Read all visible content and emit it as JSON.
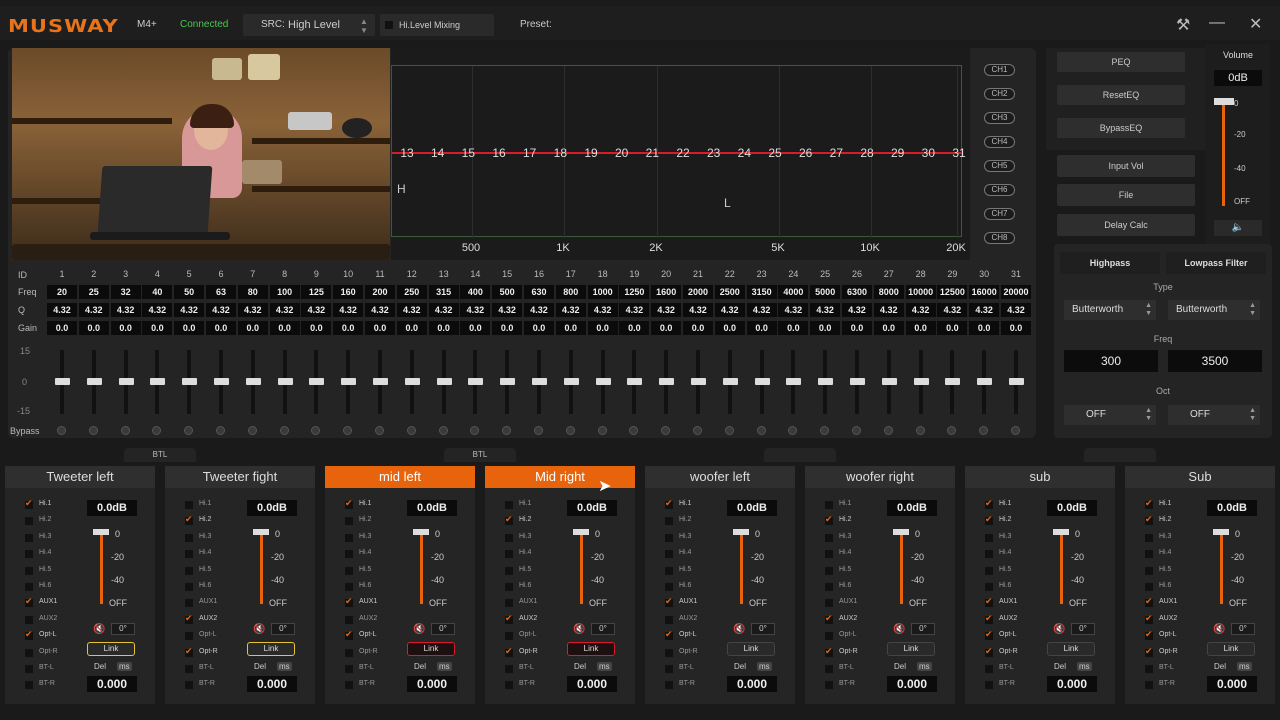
{
  "app": {
    "brand": "MUSWAY",
    "model": "M4+",
    "status": "Connected",
    "src_label": "SRC:",
    "src_value": "High Level",
    "mixing_label": "Hi.Level Mixing",
    "preset_label": "Preset:"
  },
  "colors": {
    "accent": "#e8640c",
    "status": "#4ac94a",
    "eq_curve": "#d81c2c",
    "selected_link": "#e8c33a",
    "active_link": "#d81c2c"
  },
  "eq": {
    "band_numbers": [
      "13",
      "14",
      "15",
      "16",
      "17",
      "18",
      "19",
      "20",
      "21",
      "22",
      "23",
      "24",
      "25",
      "26",
      "27",
      "28",
      "29",
      "30",
      "31"
    ],
    "freq_axis": [
      "500",
      "1K",
      "2K",
      "5K",
      "10K",
      "20K"
    ],
    "h_label": "H",
    "l_label": "L",
    "channels": [
      "CH1",
      "CH2",
      "CH3",
      "CH4",
      "CH5",
      "CH6",
      "CH7",
      "CH8"
    ]
  },
  "table": {
    "row_labels": {
      "id": "ID",
      "freq": "Freq",
      "q": "Q",
      "gain": "Gain",
      "bypass": "Bypass"
    },
    "scale": {
      "top": "15",
      "mid": "0",
      "bottom": "-15"
    },
    "ids": [
      "1",
      "2",
      "3",
      "4",
      "5",
      "6",
      "7",
      "8",
      "9",
      "10",
      "11",
      "12",
      "13",
      "14",
      "15",
      "16",
      "17",
      "18",
      "19",
      "20",
      "21",
      "22",
      "23",
      "24",
      "25",
      "26",
      "27",
      "28",
      "29",
      "30",
      "31"
    ],
    "freqs": [
      "20",
      "25",
      "32",
      "40",
      "50",
      "63",
      "80",
      "100",
      "125",
      "160",
      "200",
      "250",
      "315",
      "400",
      "500",
      "630",
      "800",
      "1000",
      "1250",
      "1600",
      "2000",
      "2500",
      "3150",
      "4000",
      "5000",
      "6300",
      "8000",
      "10000",
      "12500",
      "16000",
      "20000"
    ],
    "q": "4.32",
    "gain": "0.0"
  },
  "right": {
    "peq": "PEQ",
    "reset_eq": "ResetEQ",
    "bypass_eq": "BypassEQ",
    "input_vol": "Input Vol",
    "file": "File",
    "delay_calc": "Delay Calc",
    "volume_label": "Volume",
    "volume_value": "0dB",
    "volume_scale": [
      "0",
      "-20",
      "-40",
      "OFF"
    ],
    "highpass": "Highpass",
    "lowpass": "Lowpass Filter",
    "type_label": "Type",
    "hp_type": "Butterworth",
    "lp_type": "Butterworth",
    "freq_label": "Freq",
    "hp_freq": "300",
    "lp_freq": "3500",
    "oct_label": "Oct",
    "hp_oct": "OFF",
    "lp_oct": "OFF"
  },
  "btl": [
    "BTL",
    "BTL"
  ],
  "outputs": [
    {
      "name": "Tweeter left",
      "checked": [
        0,
        6,
        8
      ],
      "active": false,
      "link": "yellow"
    },
    {
      "name": "Tweeter fight",
      "checked": [
        1,
        7,
        9
      ],
      "active": false,
      "link": "yellow"
    },
    {
      "name": "mid left",
      "checked": [
        0,
        6,
        8
      ],
      "active": true,
      "link": "red"
    },
    {
      "name": "Mid right",
      "checked": [
        1,
        7,
        9
      ],
      "active": true,
      "link": "red"
    },
    {
      "name": "woofer left",
      "checked": [
        0,
        6,
        8
      ],
      "active": false,
      "link": "none"
    },
    {
      "name": "woofer right",
      "checked": [
        1,
        7,
        9
      ],
      "active": false,
      "link": "none"
    },
    {
      "name": "sub",
      "checked": [
        0,
        1,
        6,
        7,
        8,
        9
      ],
      "active": false,
      "link": "none"
    },
    {
      "name": "Sub",
      "checked": [
        0,
        1,
        6,
        7,
        8,
        9
      ],
      "active": false,
      "link": "none"
    }
  ],
  "output_common": {
    "inputs": [
      "Hi.1",
      "Hi.2",
      "Hi.3",
      "Hi.4",
      "Hi.5",
      "Hi.6",
      "AUX1",
      "AUX2",
      "Opt-L",
      "Opt-R",
      "BT-L",
      "BT-R"
    ],
    "gain": "0.0dB",
    "scale": [
      "0",
      "-20",
      "-40",
      "OFF"
    ],
    "phase": "0°",
    "link": "Link",
    "del": "Del",
    "ms": "ms",
    "delay": "0.000"
  }
}
